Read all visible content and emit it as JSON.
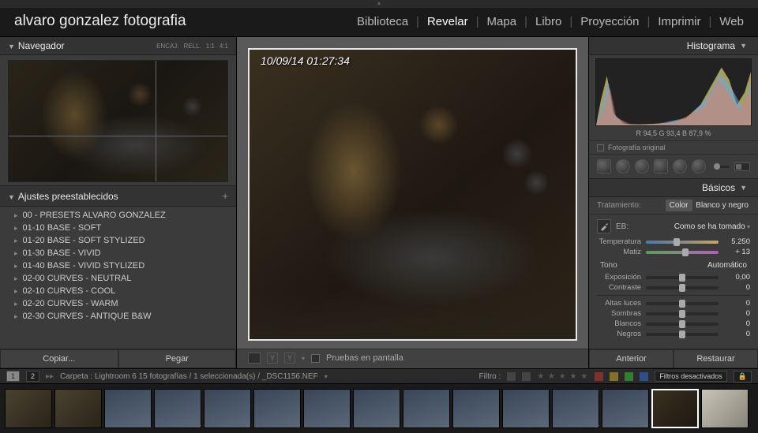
{
  "identity": "alvaro gonzalez fotografia",
  "modules": [
    "Biblioteca",
    "Revelar",
    "Mapa",
    "Libro",
    "Proyección",
    "Imprimir",
    "Web"
  ],
  "active_module": "Revelar",
  "navigator": {
    "title": "Navegador",
    "fit": "ENCAJ.",
    "fill": "RELL.",
    "r1": "1:1",
    "r2": "4:1"
  },
  "presets": {
    "title": "Ajustes preestablecidos",
    "items": [
      "00 - PRESETS ALVARO GONZALEZ",
      "01-10 BASE - SOFT",
      "01-20 BASE - SOFT STYLIZED",
      "01-30 BASE - VIVID",
      "01-40 BASE - VIVID STYLIZED",
      "02-00 CURVES - NEUTRAL",
      "02-10 CURVES - COOL",
      "02-20 CURVES - WARM",
      "02-30 CURVES - ANTIQUE B&W"
    ]
  },
  "left_footer": {
    "copy": "Copiar...",
    "paste": "Pegar"
  },
  "timestamp": "10/09/14 01:27:34",
  "softproof": "Pruebas en pantalla",
  "histogram": {
    "title": "Histograma",
    "readout": "R  94,5   G  93,4   B  87,9 %",
    "original": "Fotografía original"
  },
  "basics": {
    "title": "Básicos",
    "treatment_label": "Tratamiento:",
    "color": "Color",
    "bw": "Blanco y negro",
    "wb_label": "EB:",
    "wb_value": "Como se ha tomado",
    "temp_label": "Temperatura",
    "temp_value": "5.250",
    "tint_label": "Matiz",
    "tint_value": "+ 13",
    "tone": "Tono",
    "auto": "Automático",
    "exposure": "Exposición",
    "exposure_v": "0,00",
    "contrast": "Contraste",
    "contrast_v": "0",
    "highlights": "Altas luces",
    "highlights_v": "0",
    "shadows": "Sombras",
    "shadows_v": "0",
    "whites": "Blancos",
    "whites_v": "0",
    "blacks": "Negros",
    "blacks_v": "0"
  },
  "right_footer": {
    "prev": "Anterior",
    "reset": "Restaurar"
  },
  "filmstrip": {
    "pages": [
      "1",
      "2"
    ],
    "path": "Carpeta : Lightroom 6    15 fotografías / 1 seleccionada(s) / _DSC1156.NEF",
    "filter_label": "Filtro :",
    "filters_off": "Filtros desactivados"
  }
}
